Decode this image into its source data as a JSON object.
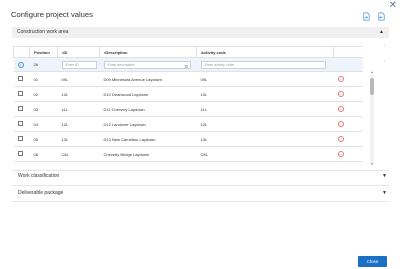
{
  "dialog": {
    "title": "Configure project values",
    "close_glyph": "✕",
    "header_icons": [
      "import-icon",
      "export-icon"
    ]
  },
  "sections": {
    "construction": {
      "title": "Construction work area",
      "expanded": true
    },
    "work_classification": {
      "title": "Work classification",
      "expanded": false
    },
    "deliverable_package": {
      "title": "Deliverable package",
      "expanded": false
    }
  },
  "table": {
    "columns": [
      "",
      "Position",
      "•ID",
      "•Description",
      "Activity code",
      ""
    ],
    "new_row": {
      "position": "26",
      "id_placeholder": "Enter ID",
      "description_placeholder": "Enter description",
      "activity_placeholder": "Enter activity code"
    },
    "rows": [
      {
        "position": "01",
        "id": "09L",
        "description": "D09 Minnesota Avenue Laydown",
        "activity_code": "09L"
      },
      {
        "position": "02",
        "id": "10L",
        "description": "D10 Deanwood Laydown",
        "activity_code": "10L"
      },
      {
        "position": "03",
        "id": "11L",
        "description": "D11 Cheverly Laydown",
        "activity_code": "11L"
      },
      {
        "position": "04",
        "id": "12L",
        "description": "D12 Landover Laydown",
        "activity_code": "12L"
      },
      {
        "position": "05",
        "id": "13L",
        "description": "D13 New Carrollton Laydown",
        "activity_code": "13L"
      },
      {
        "position": "06",
        "id": "C8L",
        "description": "Cheverly Bridge Laydown",
        "activity_code": "C8L"
      }
    ]
  },
  "footer": {
    "close_label": "Close"
  },
  "colors": {
    "primary": "#1a6fc6",
    "section_header": "#f0f0f0",
    "delete": "#e07a7a",
    "add": "#4a90d9"
  }
}
